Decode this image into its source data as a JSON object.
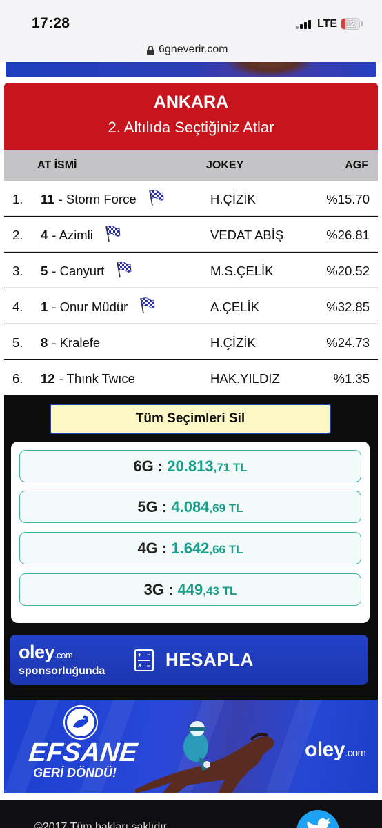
{
  "status_bar": {
    "time": "17:28",
    "network": "LTE",
    "battery": "12"
  },
  "browser": {
    "url": "6gneverir.com"
  },
  "header": {
    "city": "ANKARA",
    "subtitle": "2. Altılıda Seçtiğiniz Atlar"
  },
  "table": {
    "columns": [
      "AT İSMİ",
      "JOKEY",
      "AGF"
    ],
    "rows": [
      {
        "num": "1.",
        "horse_no": "11",
        "horse_name": "- Storm Force",
        "flag": true,
        "jokey": "H.ÇİZİK",
        "agf": "%15.70"
      },
      {
        "num": "2.",
        "horse_no": "4",
        "horse_name": "- Azimli",
        "flag": true,
        "jokey": "VEDAT ABİŞ",
        "agf": "%26.81"
      },
      {
        "num": "3.",
        "horse_no": "5",
        "horse_name": "- Canyurt",
        "flag": true,
        "jokey": "M.S.ÇELİK",
        "agf": "%20.52"
      },
      {
        "num": "4.",
        "horse_no": "1",
        "horse_name": "- Onur Müdür",
        "flag": true,
        "jokey": "A.ÇELİK",
        "agf": "%32.85"
      },
      {
        "num": "5.",
        "horse_no": "8",
        "horse_name": "- Kralefe",
        "flag": false,
        "jokey": "H.ÇİZİK",
        "agf": "%24.73"
      },
      {
        "num": "6.",
        "horse_no": "12",
        "horse_name": "- Thınk Twıce",
        "flag": false,
        "jokey": "HAK.YILDIZ",
        "agf": "%1.35"
      }
    ]
  },
  "clear_button": {
    "label": "Tüm Seçimleri Sil"
  },
  "prizes": [
    {
      "label": "6G :",
      "value": "20.813",
      "cents": ",71 TL"
    },
    {
      "label": "5G :",
      "value": "4.084",
      "cents": ",69 TL"
    },
    {
      "label": "4G :",
      "value": "1.642",
      "cents": ",66 TL"
    },
    {
      "label": "3G :",
      "value": "449",
      "cents": ",43 TL"
    }
  ],
  "hesapla": {
    "brand": "oley",
    "brand_suffix": ".com",
    "sponsor": "sponsorluğunda",
    "label": "HESAPLA"
  },
  "promo": {
    "headline": "EFSANE",
    "tagline": "GERİ DÖNDÜ!",
    "brand": "oley",
    "brand_suffix": ".com"
  },
  "footer": {
    "text": "©2017 Tüm hakları saklıdır"
  },
  "colors": {
    "header_red": "#c8141c",
    "prize_green": "#1a9e8a",
    "brand_blue": "#2342c8",
    "clear_button_bg": "#fdf8c6"
  }
}
